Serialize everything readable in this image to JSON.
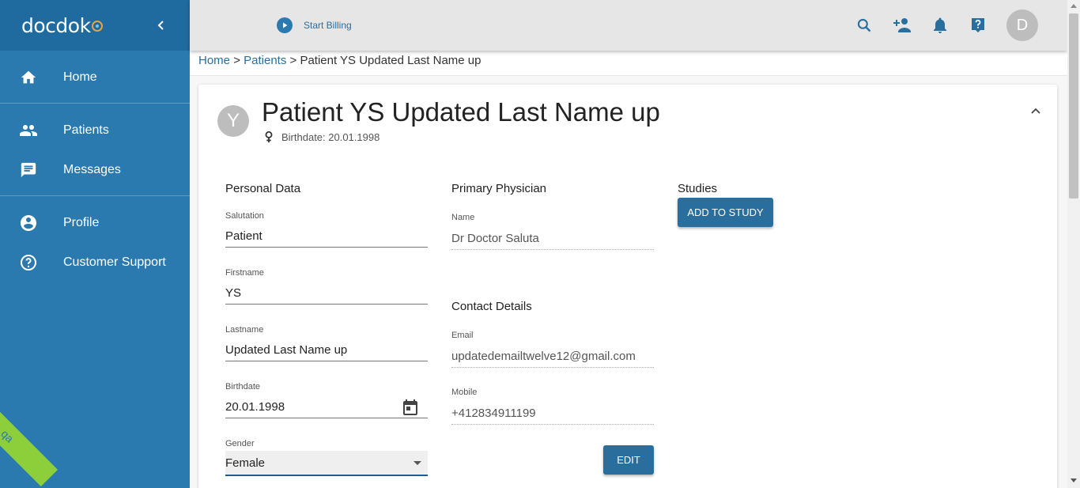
{
  "app": {
    "logo_text": "docdok",
    "brand_color": "#2a7ab0",
    "accent_color": "#2a6e9e"
  },
  "sidebar": {
    "items": [
      {
        "label": "Home",
        "icon": "home-icon"
      },
      {
        "label": "Patients",
        "icon": "people-icon"
      },
      {
        "label": "Messages",
        "icon": "message-icon"
      },
      {
        "label": "Profile",
        "icon": "account-circle-icon"
      },
      {
        "label": "Customer Support",
        "icon": "help-circle-icon"
      }
    ],
    "env_badge": "qa"
  },
  "topbar": {
    "start_billing_label": "Start Billing",
    "avatar_initial": "D",
    "icons": [
      "search-icon",
      "add-person-icon",
      "bell-icon",
      "help-icon"
    ]
  },
  "breadcrumb": {
    "home": "Home",
    "patients": "Patients",
    "current": "Patient YS Updated Last Name up",
    "separator": ">"
  },
  "patient": {
    "avatar_initial": "Y",
    "name": "Patient YS Updated Last Name up",
    "birthdate_line": "Birthdate: 20.01.1998"
  },
  "personal_data": {
    "title": "Personal Data",
    "salutation_label": "Salutation",
    "salutation": "Patient",
    "firstname_label": "Firstname",
    "firstname": "YS",
    "lastname_label": "Lastname",
    "lastname": "Updated Last Name up",
    "birthdate_label": "Birthdate",
    "birthdate": "20.01.1998",
    "gender_label": "Gender",
    "gender": "Female"
  },
  "primary_physician": {
    "title": "Primary Physician",
    "name_label": "Name",
    "name": "Dr Doctor Saluta"
  },
  "contact_details": {
    "title": "Contact Details",
    "email_label": "Email",
    "email": "updatedemailtwelve12@gmail.com",
    "mobile_label": "Mobile",
    "mobile": "+412834911199",
    "edit_label": "EDIT"
  },
  "studies": {
    "title": "Studies",
    "add_label": "ADD TO STUDY"
  }
}
